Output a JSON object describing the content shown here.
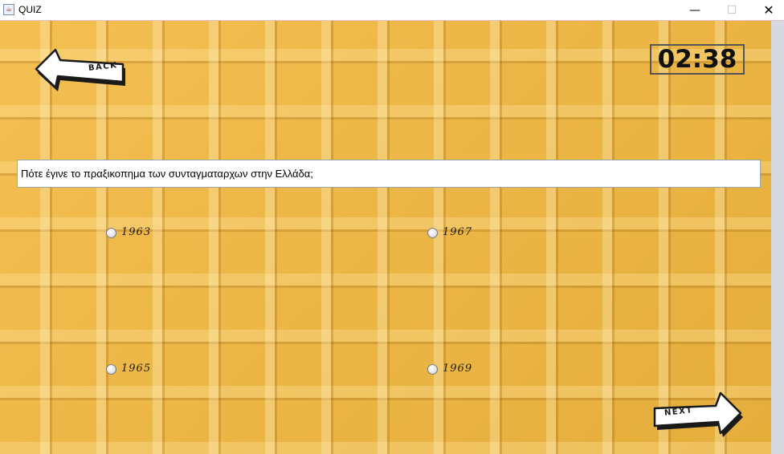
{
  "window": {
    "title": "QUIZ",
    "minimize_glyph": "—",
    "maximize_glyph": "☐",
    "close_glyph": "✕"
  },
  "navigation": {
    "back_label": "BACK",
    "next_label": "NEXT"
  },
  "timer": {
    "value": "02:38"
  },
  "question": {
    "text": "Πότε έγινε το πραξικοπημα των συνταγματαρχων στην Ελλάδα;"
  },
  "answers": [
    {
      "label": "1963"
    },
    {
      "label": "1967"
    },
    {
      "label": "1965"
    },
    {
      "label": "1969"
    }
  ],
  "colors": {
    "background": "#f3b83e",
    "arrow_fill": "#ffffff",
    "arrow_outline": "#1a1a1a"
  }
}
